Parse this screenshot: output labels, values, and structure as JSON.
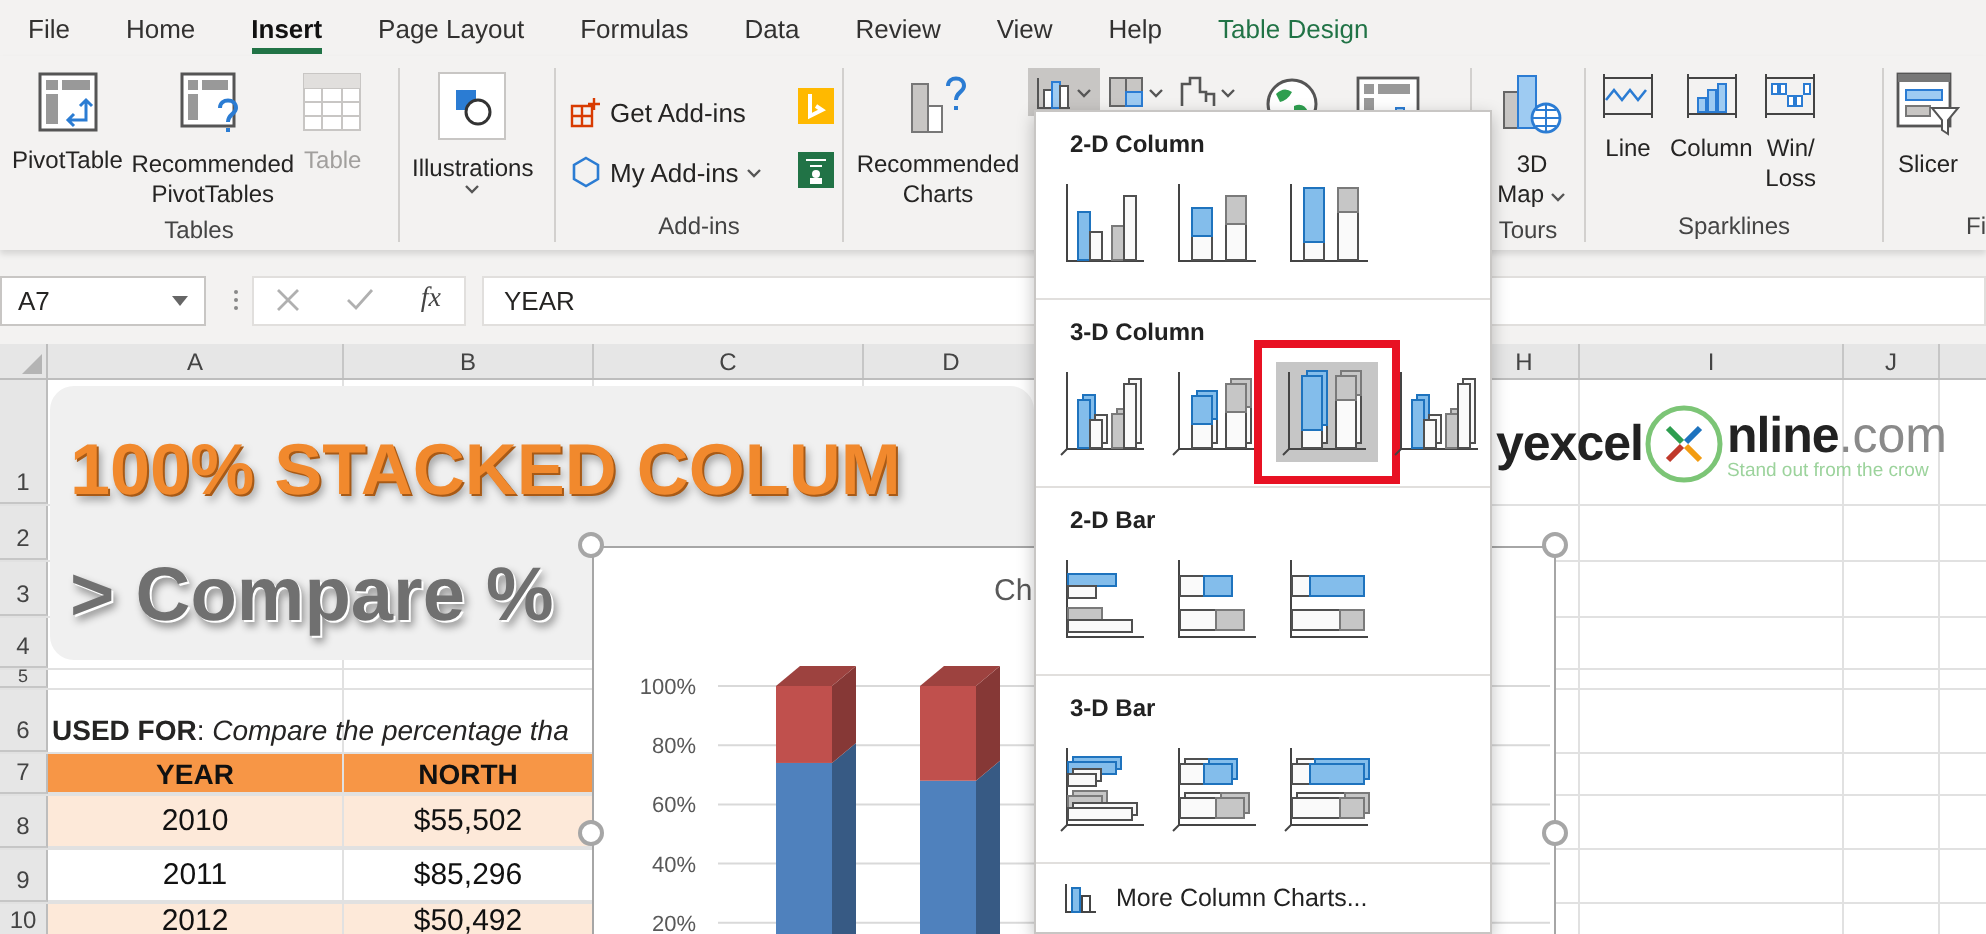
{
  "menu_tabs": [
    {
      "label": "File",
      "selected": false,
      "kind": "standard"
    },
    {
      "label": "Home",
      "selected": false,
      "kind": "standard"
    },
    {
      "label": "Insert",
      "selected": true,
      "kind": "standard"
    },
    {
      "label": "Page Layout",
      "selected": false,
      "kind": "standard"
    },
    {
      "label": "Formulas",
      "selected": false,
      "kind": "standard"
    },
    {
      "label": "Data",
      "selected": false,
      "kind": "standard"
    },
    {
      "label": "Review",
      "selected": false,
      "kind": "standard"
    },
    {
      "label": "View",
      "selected": false,
      "kind": "standard"
    },
    {
      "label": "Help",
      "selected": false,
      "kind": "standard"
    },
    {
      "label": "Table Design",
      "selected": false,
      "kind": "contextual"
    }
  ],
  "ribbon": {
    "tables": {
      "label": "Tables",
      "buttons": [
        {
          "kind": "pivot-table",
          "label": "PivotTable",
          "disabled": false
        },
        {
          "kind": "recommended-pivot",
          "label": "Recommended PivotTables",
          "disabled": false
        },
        {
          "kind": "table",
          "label": "Table",
          "disabled": true
        }
      ]
    },
    "illustrations": {
      "label": "Illustrations"
    },
    "addins": {
      "label": "Add-ins",
      "buttons": [
        {
          "kind": "get-addins",
          "label": "Get Add-ins"
        },
        {
          "kind": "my-addins",
          "label": "My Add-ins"
        }
      ]
    },
    "charts": {
      "recommended": "Recommended Charts",
      "gallery": [
        {
          "kind": "column-chart",
          "selected": true
        },
        {
          "kind": "hierarchy-chart",
          "selected": false
        },
        {
          "kind": "waterfall-chart",
          "selected": false
        }
      ]
    },
    "tours": {
      "label": "Tours",
      "button": "3D Map"
    },
    "sparklines": {
      "label": "Sparklines",
      "buttons": [
        {
          "kind": "sparkline-line",
          "label": "Line"
        },
        {
          "kind": "sparkline-column",
          "label": "Column"
        },
        {
          "kind": "sparkline-winloss",
          "label": "Win/Loss"
        }
      ]
    },
    "filters": {
      "label": "Fi",
      "button": "Slicer"
    }
  },
  "formula_bar": {
    "name_box": "A7",
    "function_label": "fx",
    "formula": "YEAR"
  },
  "column_headers": [
    "A",
    "B",
    "C",
    "D",
    "H",
    "I",
    "J"
  ],
  "row_headers": [
    "1",
    "2",
    "3",
    "4",
    "5",
    "6",
    "7",
    "8",
    "9",
    "10"
  ],
  "banner": {
    "title": "100% STACKED COLUM",
    "subtitle": "> Compare %"
  },
  "used_for": "**USED FOR**: *Compare the percentage tha*",
  "table": {
    "columns": [
      "YEAR",
      "NORTH"
    ],
    "rows": [
      [
        "2010",
        "$55,502"
      ],
      [
        "2011",
        "$85,296"
      ],
      [
        "2012",
        "$50,492"
      ]
    ]
  },
  "chart": {
    "chart_data": {
      "type": "bar",
      "title": "Ch",
      "stacked": true,
      "orientation": "vertical",
      "grid": true,
      "ylim": [
        0,
        1
      ],
      "yticks": [
        {
          "value": 0.2,
          "label": "20%"
        },
        {
          "value": 0.4,
          "label": "40%"
        },
        {
          "value": 0.6,
          "label": "60%"
        },
        {
          "value": 0.8,
          "label": "80%"
        },
        {
          "value": 1,
          "label": "100%"
        }
      ],
      "series": [
        {
          "color": "#4f81bd",
          "values": [
            0.74,
            0.68
          ]
        },
        {
          "color": "#c0504d",
          "values": [
            0.26,
            0.32
          ]
        }
      ]
    }
  },
  "logo": {
    "lead": "yexcel",
    "tail": "nline",
    "domain": ".com",
    "tagline": "Stand out from the crow"
  },
  "chart_menu": {
    "sections": [
      {
        "title": "2-D Column",
        "items": [
          {
            "kind": "clustered-column",
            "selected": false
          },
          {
            "kind": "stacked-column",
            "selected": false
          },
          {
            "kind": "percent-column",
            "selected": false
          }
        ]
      },
      {
        "title": "3-D Column",
        "items": [
          {
            "kind": "clustered-column-3d",
            "selected": false
          },
          {
            "kind": "stacked-column-3d",
            "selected": false
          },
          {
            "kind": "percent-column-3d",
            "selected": true
          },
          {
            "kind": "column-3d",
            "selected": false
          }
        ]
      },
      {
        "title": "2-D Bar",
        "items": [
          {
            "kind": "clustered-bar",
            "selected": false
          },
          {
            "kind": "stacked-bar",
            "selected": false
          },
          {
            "kind": "percent-bar",
            "selected": false
          }
        ]
      },
      {
        "title": "3-D Bar",
        "items": [
          {
            "kind": "clustered-bar-3d",
            "selected": false
          },
          {
            "kind": "stacked-bar-3d",
            "selected": false
          },
          {
            "kind": "percent-bar-3d",
            "selected": false
          }
        ]
      }
    ],
    "footer": "More Column Charts..."
  }
}
